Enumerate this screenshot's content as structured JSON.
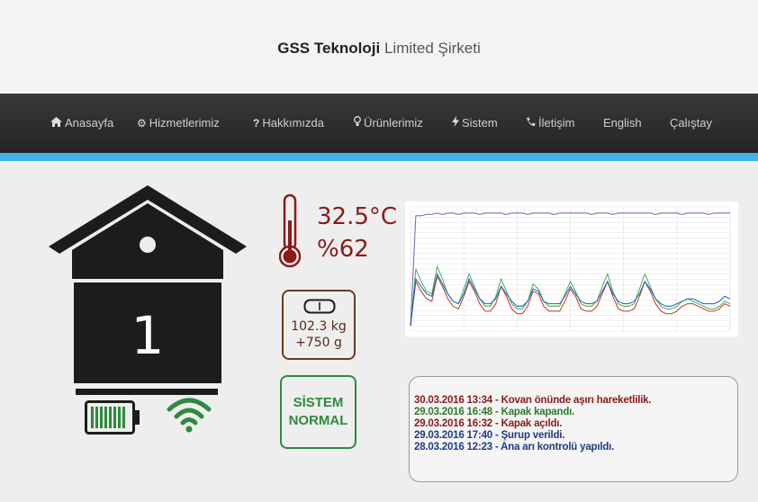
{
  "header": {
    "brand_bold": "GSS Teknoloji",
    "brand_rest": "Limited Şirketi"
  },
  "nav": {
    "items": [
      {
        "label": "Anasayfa",
        "icon": "home-icon"
      },
      {
        "label": "Hizmetlerimiz",
        "icon": "gears-icon"
      },
      {
        "label": "Hakkımızda",
        "icon": "question-icon"
      },
      {
        "label": "Ürünlerimiz",
        "icon": "lightbulb-icon"
      },
      {
        "label": "Sistem",
        "icon": "bolt-icon"
      },
      {
        "label": "İletişim",
        "icon": "phone-icon"
      },
      {
        "label": "English",
        "icon": ""
      },
      {
        "label": "Çalıştay",
        "icon": ""
      }
    ]
  },
  "hive": {
    "number": "1",
    "battery_level": 1.0,
    "wifi": "connected"
  },
  "sensors": {
    "temperature": "32.5°C",
    "humidity": "%62",
    "weight": "102.3 kg",
    "weight_change": "+750 g"
  },
  "status": {
    "line1": "SİSTEM",
    "line2": "NORMAL"
  },
  "log": {
    "entries": [
      {
        "text": "30.03.2016 13:34 - Kovan önünde aşırı hareketlilik.",
        "color": "#8b1a1a"
      },
      {
        "text": "29.03.2016 16:48 - Kapak kapandı.",
        "color": "#2d7a2d"
      },
      {
        "text": "29.03.2016 16:32 - Kapak açıldı.",
        "color": "#8b1a1a"
      },
      {
        "text": "29.03.2016 17:40 - Şurup verildi.",
        "color": "#1f3a8a"
      },
      {
        "text": "28.03.2016 12:23 -  Ana arı kontrolü yapıldı.",
        "color": "#1f3a8a"
      }
    ]
  },
  "colors": {
    "accent": "#3fb3e8",
    "navbar": "#2b2b2b",
    "hive": "#1c1c1c",
    "temperature": "#8b1a1a",
    "status_ok": "#2d8a3e"
  },
  "chart_data": {
    "type": "line",
    "x": [
      0,
      1,
      2,
      3,
      4,
      5,
      6,
      7,
      8,
      9,
      10,
      11,
      12,
      13,
      14,
      15,
      16,
      17,
      18,
      19,
      20,
      21,
      22,
      23,
      24,
      25,
      26,
      27,
      28,
      29,
      30,
      31,
      32,
      33,
      34,
      35,
      36,
      37,
      38,
      39,
      40,
      41,
      42,
      43,
      44,
      45,
      46,
      47,
      48,
      49,
      50,
      51,
      52,
      53,
      54,
      55,
      56,
      57,
      58,
      59,
      60
    ],
    "series": [
      {
        "color": "#7b5fb3",
        "values": [
          4,
          93,
          93,
          94,
          94,
          95,
          94,
          95,
          95,
          94,
          95,
          95,
          95,
          94,
          95,
          95,
          95,
          95,
          94,
          95,
          95,
          95,
          94,
          95,
          95,
          95,
          95,
          94,
          95,
          95,
          95,
          95,
          95,
          95,
          94,
          95,
          95,
          95,
          94,
          95,
          95,
          95,
          95,
          95,
          95,
          95,
          94,
          95,
          95,
          95,
          95,
          94,
          95,
          95,
          95,
          95,
          94,
          95,
          95,
          95,
          95
        ]
      },
      {
        "color": "#4caf50",
        "values": [
          4,
          50,
          40,
          32,
          30,
          52,
          42,
          30,
          24,
          22,
          34,
          46,
          36,
          26,
          20,
          20,
          28,
          42,
          32,
          22,
          18,
          18,
          24,
          38,
          34,
          24,
          20,
          20,
          20,
          30,
          40,
          32,
          22,
          20,
          20,
          24,
          36,
          46,
          32,
          22,
          20,
          20,
          22,
          34,
          46,
          36,
          26,
          20,
          18,
          18,
          20,
          24,
          26,
          24,
          22,
          20,
          18,
          18,
          20,
          24,
          22
        ]
      },
      {
        "color": "#c0392b",
        "values": [
          4,
          40,
          32,
          26,
          24,
          44,
          36,
          26,
          20,
          18,
          28,
          40,
          32,
          22,
          16,
          16,
          22,
          36,
          28,
          18,
          14,
          14,
          20,
          32,
          30,
          20,
          16,
          16,
          16,
          24,
          34,
          28,
          18,
          16,
          16,
          20,
          30,
          40,
          28,
          18,
          16,
          16,
          18,
          28,
          40,
          32,
          22,
          16,
          14,
          14,
          16,
          20,
          22,
          22,
          20,
          18,
          16,
          16,
          18,
          22,
          20
        ]
      },
      {
        "color": "#1565c0",
        "values": [
          4,
          42,
          36,
          30,
          28,
          46,
          38,
          30,
          24,
          22,
          30,
          42,
          34,
          26,
          22,
          22,
          26,
          36,
          30,
          24,
          20,
          20,
          24,
          34,
          32,
          24,
          22,
          22,
          22,
          28,
          36,
          30,
          24,
          22,
          22,
          24,
          32,
          40,
          30,
          24,
          22,
          22,
          24,
          30,
          40,
          34,
          26,
          22,
          20,
          20,
          22,
          24,
          26,
          26,
          24,
          22,
          22,
          22,
          24,
          28,
          26
        ]
      }
    ],
    "ylim": [
      0,
      100
    ],
    "grid": true
  }
}
